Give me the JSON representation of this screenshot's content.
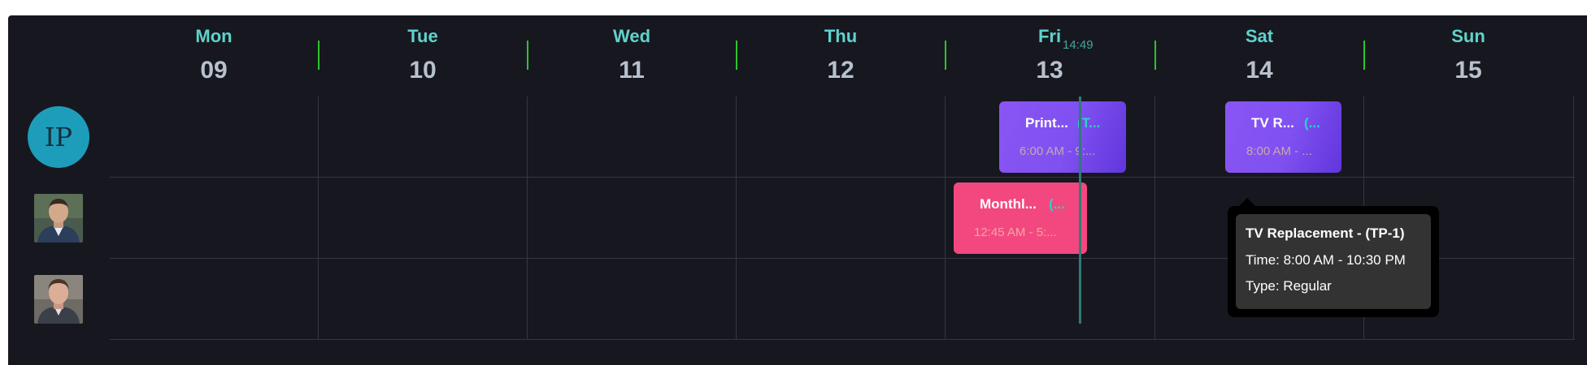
{
  "week": {
    "days": [
      {
        "name": "Mon",
        "date": "09"
      },
      {
        "name": "Tue",
        "date": "10"
      },
      {
        "name": "Wed",
        "date": "11"
      },
      {
        "name": "Thu",
        "date": "12"
      },
      {
        "name": "Fri",
        "date": "13"
      },
      {
        "name": "Sat",
        "date": "14"
      },
      {
        "name": "Sun",
        "date": "15"
      }
    ]
  },
  "now_indicator": {
    "time": "14:49"
  },
  "resources": [
    {
      "type": "initials",
      "initials": "IP",
      "color": "#1e9dbb"
    },
    {
      "type": "photo",
      "icon": "person-photo-1"
    },
    {
      "type": "photo",
      "icon": "person-photo-2"
    }
  ],
  "events": [
    {
      "title": "Print...",
      "code": "(T...",
      "time": "6:00 AM - 9:...",
      "color": "#8a55f4"
    },
    {
      "title": "TV R...",
      "code": "(...",
      "time": "8:00 AM - ...",
      "color": "#8a55f4"
    },
    {
      "title": "Monthl...",
      "code": "(...",
      "time": "12:45 AM - 5:...",
      "color": "#f3487f"
    }
  ],
  "tooltip": {
    "title": "TV Replacement - (TP-1)",
    "time_line": "Time: 8:00 AM - 10:30 PM",
    "type_line": "Type: Regular"
  },
  "colors": {
    "background": "#17181f",
    "day_name": "#5fd3cc",
    "day_number": "#b7c1cc",
    "day_tick": "#2cc52c",
    "now_line": "#2f7a78",
    "event_purple": "#8a55f4",
    "event_pink": "#f3487f"
  }
}
